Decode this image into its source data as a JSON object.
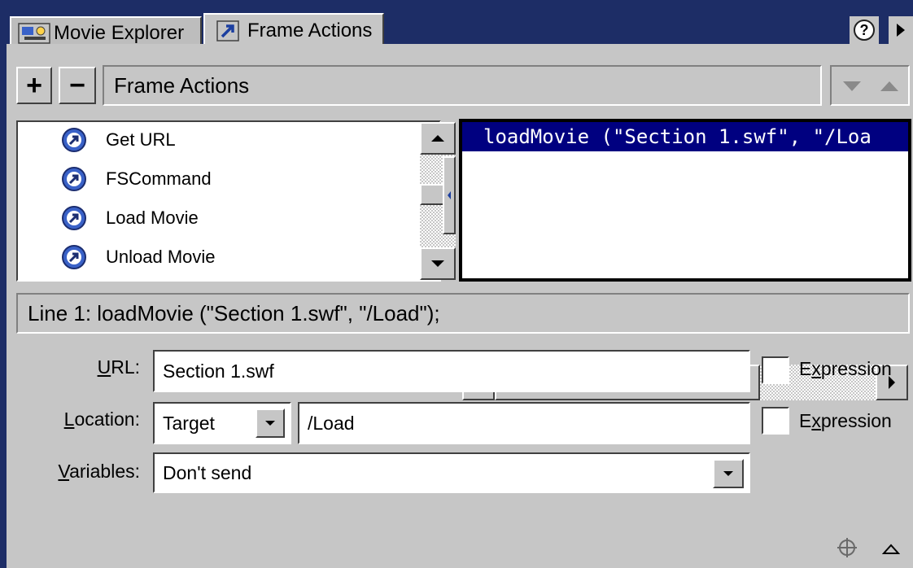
{
  "tabs": [
    {
      "label": "Movie Explorer",
      "icon": "movie-explorer-icon"
    },
    {
      "label": "Frame Actions",
      "icon": "frame-actions-icon"
    }
  ],
  "help_glyph": "?",
  "toolbar": {
    "add_glyph": "+",
    "remove_glyph": "−",
    "title": "Frame Actions"
  },
  "actions": [
    {
      "label": "Get URL"
    },
    {
      "label": "FSCommand"
    },
    {
      "label": "Load Movie"
    },
    {
      "label": "Unload Movie"
    }
  ],
  "code": {
    "line": "loadMovie (\"Section 1.swf\", \"/Loa"
  },
  "status": {
    "text": "Line 1: loadMovie (\"Section 1.swf\", \"/Load\");"
  },
  "form": {
    "url_label_u": "U",
    "url_label_rest": "RL:",
    "url_value": "Section 1.swf",
    "location_label_u": "L",
    "location_label_rest": "ocation:",
    "location_type": "Target",
    "location_value": "/Load",
    "variables_label_u": "V",
    "variables_label_rest": "ariables:",
    "variables_value": "Don't send",
    "expression_label_1_pre": "E",
    "expression_label_1_u": "x",
    "expression_label_1_post": "pression",
    "expression_label_2_pre": "E",
    "expression_label_2_u": "x",
    "expression_label_2_post": "pression"
  },
  "colors": {
    "frame": "#1d2d66",
    "panel": "#c6c6c6",
    "selection": "#000080",
    "action_icon": "#3a62c8"
  }
}
